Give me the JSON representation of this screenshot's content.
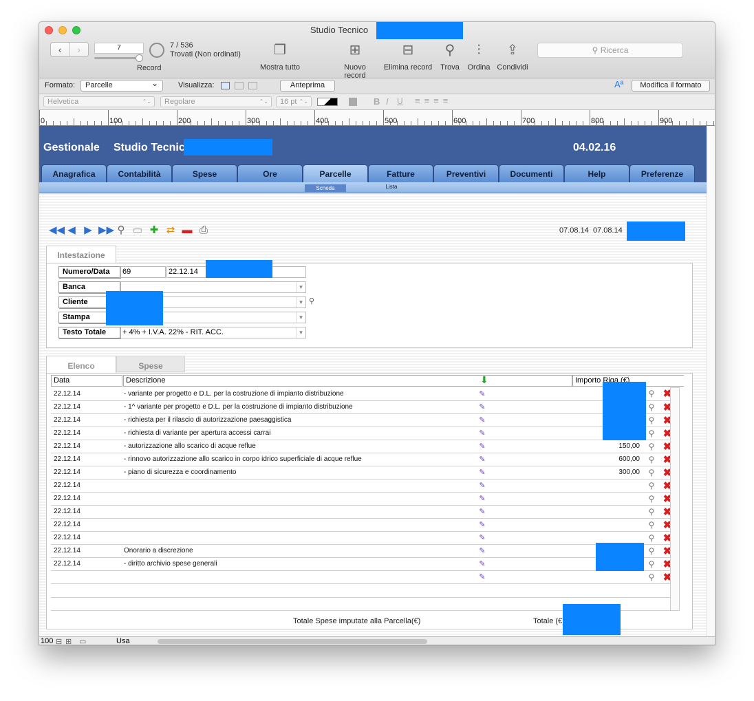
{
  "window": {
    "title": "Studio Tecnico"
  },
  "toolbar": {
    "record_value": "7",
    "record_label": "Record",
    "count": "7 / 536",
    "found_status": "Trovati (Non ordinati)",
    "show_all": "Mostra tutto",
    "new_record": "Nuovo record",
    "delete_record": "Elimina record",
    "find": "Trova",
    "sort": "Ordina",
    "share": "Condividi",
    "search_placeholder": "Ricerca"
  },
  "format_bar": {
    "format_label": "Formato:",
    "format_value": "Parcelle",
    "view_label": "Visualizza:",
    "preview": "Anteprima",
    "edit_layout": "Modifica il formato"
  },
  "text_bar": {
    "font": "Helvetica",
    "style": "Regolare",
    "size": "16 pt"
  },
  "ruler": {
    "marks": [
      "0",
      "100",
      "200",
      "300",
      "400",
      "500",
      "600",
      "700",
      "800",
      "900"
    ]
  },
  "header": {
    "app": "Gestionale",
    "company": "Studio Tecnico",
    "date": "04.02.16"
  },
  "tabs": [
    "Anagrafica",
    "Contabilità",
    "Spese",
    "Ore",
    "Parcelle",
    "Fatture",
    "Preventivi",
    "Documenti",
    "Help",
    "Preferenze"
  ],
  "subtabs": {
    "scheda": "Scheda",
    "lista": "Lista"
  },
  "record_dates": {
    "created": "07.08.14",
    "modified": "07.08.14"
  },
  "intestazione": {
    "tab": "Intestazione",
    "numero_label": "Numero/Data",
    "numero": "69",
    "data": "22.12.14",
    "banca_label": "Banca",
    "cliente_label": "Cliente",
    "stampa_label": "Stampa",
    "testo_label": "Testo Totale",
    "testo_value": "+ 4% + I.V.A. 22% - RIT. ACC."
  },
  "elenco": {
    "tab_elenco": "Elenco",
    "tab_spese": "Spese",
    "col_data": "Data",
    "col_descrizione": "Descrizione",
    "col_importo": "Importo Riga (€)",
    "rows": [
      {
        "data": "22.12.14",
        "desc": "- variante per progetto e D.L. per la costruzione di impianto distribuzione",
        "importo": ""
      },
      {
        "data": "22.12.14",
        "desc": "- 1^ variante per progetto e D.L. per la costruzione di impianto distribuzione",
        "importo": ""
      },
      {
        "data": "22.12.14",
        "desc": "- richiesta per il rilascio di autorizzazione paesaggistica",
        "importo": ""
      },
      {
        "data": "22.12.14",
        "desc": "- richiesta di variante per apertura accessi carrai",
        "importo": ""
      },
      {
        "data": "22.12.14",
        "desc": "- autorizzazione allo scarico di acque reflue",
        "importo": "150,00"
      },
      {
        "data": "22.12.14",
        "desc": "- rinnovo autorizzazione allo scarico in corpo idrico superficiale di acque reflue",
        "importo": "600,00"
      },
      {
        "data": "22.12.14",
        "desc": "- piano di sicurezza e coordinamento",
        "importo": "300,00"
      },
      {
        "data": "22.12.14",
        "desc": "",
        "importo": ""
      },
      {
        "data": "22.12.14",
        "desc": "",
        "importo": ""
      },
      {
        "data": "22.12.14",
        "desc": "",
        "importo": ""
      },
      {
        "data": "22.12.14",
        "desc": "",
        "importo": ""
      },
      {
        "data": "22.12.14",
        "desc": "",
        "importo": ""
      },
      {
        "data": "22.12.14",
        "desc": "Onorario a discrezione",
        "importo": ""
      },
      {
        "data": "22.12.14",
        "desc": "- diritto archivio spese generali",
        "importo": ""
      },
      {
        "data": "",
        "desc": "",
        "importo": ""
      }
    ],
    "totale_spese": "Totale Spese imputate alla Parcella(€)",
    "totale": "Totale (€)"
  },
  "statusbar": {
    "zoom": "100",
    "mode": "Usa"
  }
}
